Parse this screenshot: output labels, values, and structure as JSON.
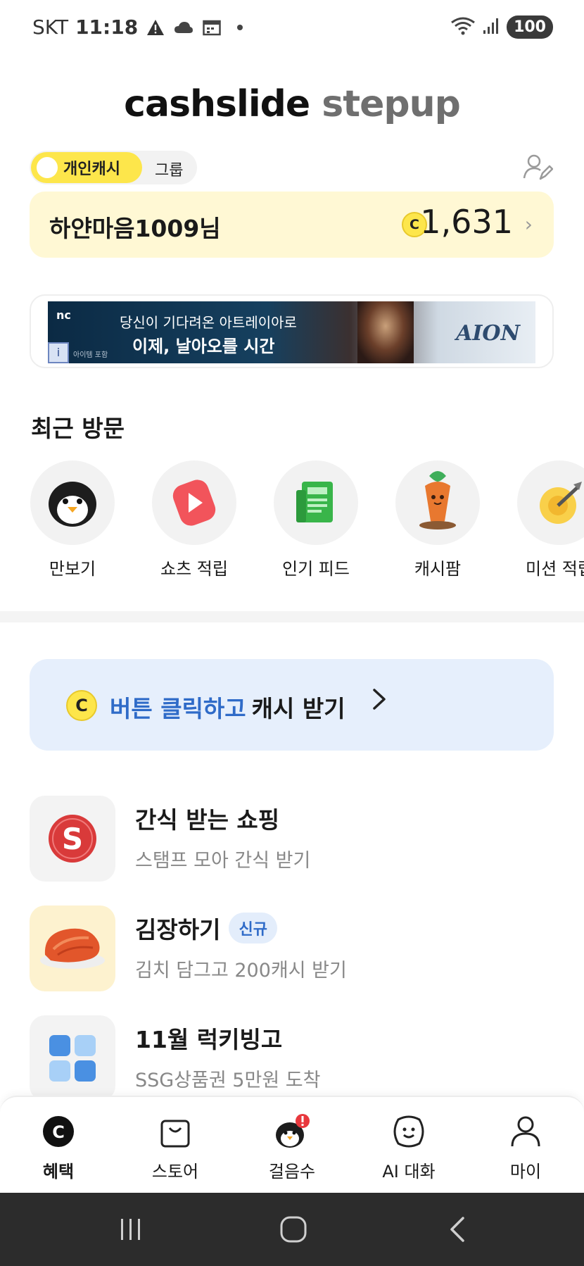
{
  "status_bar": {
    "carrier": "SKT",
    "time": "11:18",
    "battery": "100"
  },
  "logo": {
    "part1": "cashslide",
    "part2": "stepup"
  },
  "toggle": {
    "active_label": "개인캐시",
    "inactive_label": "그룹"
  },
  "user_card": {
    "name": "하얀마음1009님",
    "coin_symbol": "C",
    "cash": "1,631"
  },
  "banner": {
    "brand": "nc",
    "line1": "당신이 기다려온 아트레이아로",
    "line2": "이제, 날아오를 시간",
    "logo": "AION",
    "sub": "아이템 포함",
    "info": "i"
  },
  "recent": {
    "title": "최근 방문",
    "items": [
      {
        "label": "만보기",
        "icon": "penguin-icon"
      },
      {
        "label": "쇼츠 적립",
        "icon": "shorts-play-icon"
      },
      {
        "label": "인기 피드",
        "icon": "newspaper-icon"
      },
      {
        "label": "캐시팜",
        "icon": "carrot-icon"
      },
      {
        "label": "미션 적립",
        "icon": "target-icon"
      }
    ]
  },
  "cta": {
    "coin_symbol": "C",
    "blue_text": "버튼 클릭하고",
    "dark_text": "캐시 받기",
    "chevron": ">"
  },
  "list": [
    {
      "title": "간식 받는 쇼핑",
      "subtitle": "스탬프 모아 간식 받기",
      "badge": "",
      "icon": "s-badge-icon"
    },
    {
      "title": "김장하기",
      "subtitle": "김치 담그고 200캐시 받기",
      "badge": "신규",
      "icon": "kimchi-icon"
    },
    {
      "title": "11월 럭키빙고",
      "subtitle": "SSG상품권 5만원 도착",
      "badge": "",
      "icon": "bingo-grid-icon"
    }
  ],
  "bottom_nav": [
    {
      "label": "혜택",
      "active": true
    },
    {
      "label": "스토어",
      "active": false
    },
    {
      "label": "걸음수",
      "active": false
    },
    {
      "label": "AI 대화",
      "active": false
    },
    {
      "label": "마이",
      "active": false
    }
  ],
  "colors": {
    "accent_yellow": "#fde64b",
    "card_yellow": "#fff8d4",
    "cta_blue_bg": "#e6effc",
    "cta_blue_text": "#2f6bc8",
    "system_nav": "#2c2c2c"
  }
}
